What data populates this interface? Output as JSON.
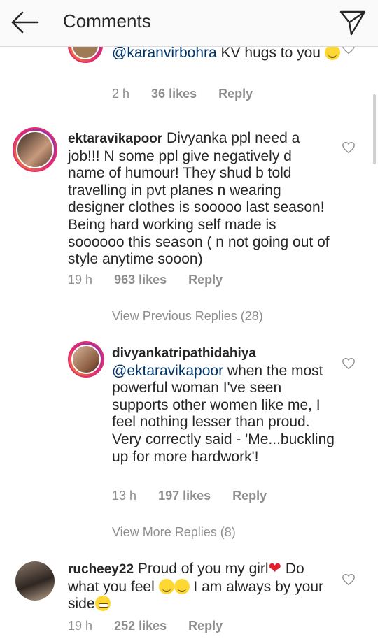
{
  "header": {
    "title": "Comments",
    "back_icon": "arrow-left-icon",
    "share_icon": "paper-plane-icon"
  },
  "comments": [
    {
      "mention": "@karanvirbohra",
      "text": " KV hugs to you ",
      "time": "2 h",
      "likes": "36 likes",
      "reply": "Reply"
    },
    {
      "username": "ektaravikapoor",
      "text": " Divyanka ppl need a job!!! N some ppl give negatively d name of humour! They shud b told travelling in pvt planes n wearing designer clothes is sooooo last season! Being hard working self made is soooooo this season ( n not going out of style anytime sooon)",
      "time": "19 h",
      "likes": "963 likes",
      "reply": "Reply"
    },
    {
      "username": "divyankatripathidahiya",
      "mention": "@ektaravikapoor",
      "text": " when the most powerful woman I've seen supports other women like me, I feel nothing lesser than proud. Very correctly said - 'Me...buckling up for more hardwork'!",
      "time": "13 h",
      "likes": "197 likes",
      "reply": "Reply"
    },
    {
      "username": "rucheey22",
      "text_a": " Proud of you my girl",
      "text_b": " Do what you feel ",
      "text_c": " I am always by your side",
      "time": "19 h",
      "likes": "252 likes",
      "reply": "Reply"
    }
  ],
  "links": {
    "view_previous": "View Previous Replies (28)",
    "view_more": "View More Replies (8)"
  },
  "colors": {
    "text": "#262626",
    "meta": "#8e8e8e",
    "mention": "#003569",
    "story_ring": "#e1306c"
  }
}
